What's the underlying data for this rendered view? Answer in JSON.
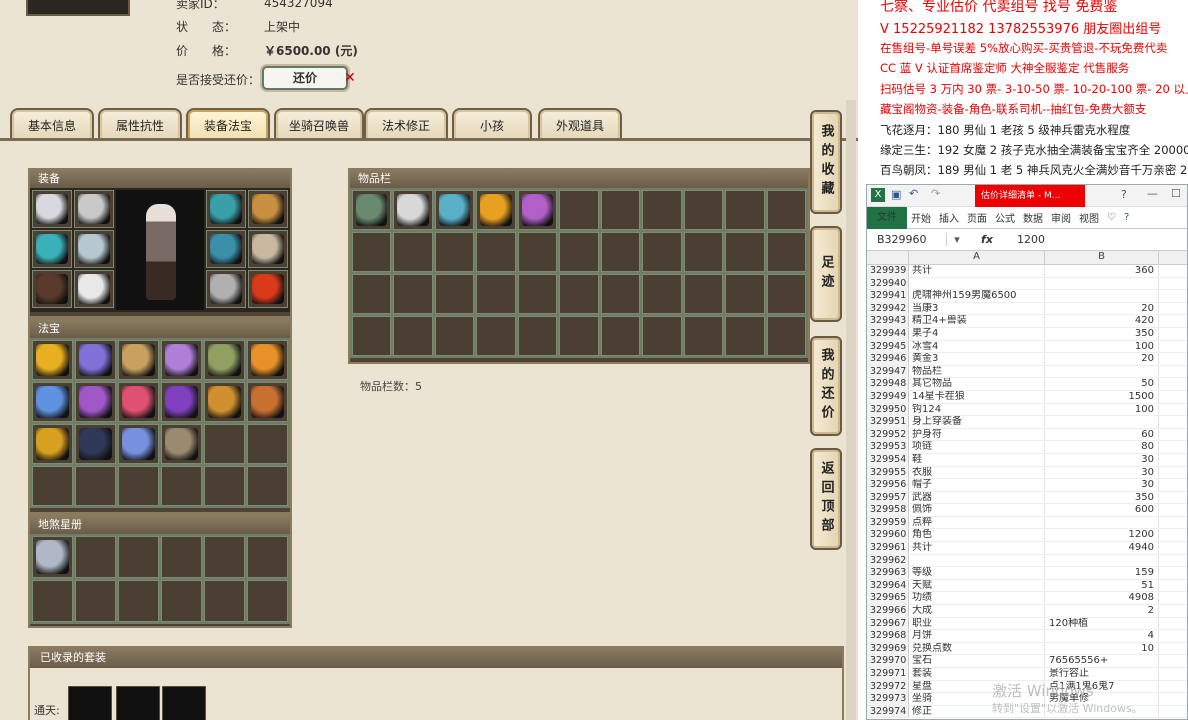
{
  "seller": {
    "id_label": "卖家ID：",
    "id_value": "454327094",
    "status_label": "状　　态：",
    "status_value": "上架中",
    "price_label": "价　　格：",
    "price_value": "￥6500.00 (元)",
    "offer_label": "是否接受还价：",
    "offer_button": "还价"
  },
  "tabs": [
    "基本信息",
    "属性抗性",
    "装备法宝",
    "坐骑召唤兽",
    "法术修正",
    "小孩",
    "外观道具"
  ],
  "panels": {
    "equip_title": "装备",
    "treasure_title": "法宝",
    "book_title": "地煞星册",
    "inventory_title": "物品栏",
    "inventory_count": "物品栏数：5",
    "suit_title": "已收录的套装",
    "suit_label": "通天:"
  },
  "side_nav": [
    "我的收藏",
    "足迹",
    "我的还价",
    "返回顶部"
  ],
  "colors": {
    "equip": [
      "#d8d8e0",
      "#c9c9c9",
      "#3ab0b8",
      "#b8c8d0",
      "#5a3a2a",
      "#e8e8e8",
      "#38a0a8",
      "#c89040",
      "#3a90a8",
      "#c8b8a0",
      "#b0b0b0",
      "#d83a1a"
    ],
    "inventory": [
      "#6a8a70",
      "#d8d8d8",
      "#5ab0c8",
      "#e8a020",
      "#b060c8"
    ],
    "treasure": [
      "#e8b020",
      "#8070d8",
      "#c8a060",
      "#b080d8",
      "#90a060",
      "#e8902a",
      "#6090e0",
      "#a058c8",
      "#e05070",
      "#8040c0",
      "#d09030",
      "#c87030",
      "#d8a020",
      "#303858",
      "#7890e0",
      "#9a8a70"
    ],
    "book": [
      "#b0b8c8"
    ]
  },
  "ads": {
    "line0": "七察、专业估价 代卖组号 找号 免费鉴",
    "line1": "V 15225921182   13782553976 朋友圈出组号",
    "line2": "在售组号-单号误差 5%放心购买-买贵管退-不玩免费代卖",
    "line3": "CC 蓝 V 认证首席鉴定师 大神全服鉴定 代售服务",
    "line4": "扫码估号 3 万内 30 票- 3-10-50 票- 10-20-100 票- 20 以上 150",
    "line5": "藏宝阁物资-装备-角色-联系司机--抽红包-免费大额支",
    "line6": "飞花逐月：180 男仙 1 老孩 5 级神兵雷克水程度",
    "line7": "缘定三生：192 女魔 2 孩子克水抽全满装备宝宝齐全 20000",
    "line8": "百鸟朝凤：189 男仙 1 老 5 神兵风克火全满妙音千万亲密 228"
  },
  "excel": {
    "tab_title": "估价详细清单 - M...",
    "ribbon": [
      "文件",
      "开始",
      "插入",
      "页面",
      "公式",
      "数据",
      "审阅",
      "视图"
    ],
    "cell_ref": "B329960",
    "fx": "fx",
    "formula_value": "1200",
    "col_a": "A",
    "col_b": "B",
    "rows": [
      [
        "329939",
        "共计",
        "360"
      ],
      [
        "329940",
        "",
        ""
      ],
      [
        "329941",
        "虎啸神州159男魔6500",
        ""
      ],
      [
        "329942",
        "当康3",
        "20"
      ],
      [
        "329943",
        "精卫4+兽装",
        "420"
      ],
      [
        "329944",
        "果子4",
        "350"
      ],
      [
        "329945",
        "冰雪4",
        "100"
      ],
      [
        "329946",
        "黄金3",
        "20"
      ],
      [
        "329947",
        "物品栏",
        ""
      ],
      [
        "329948",
        "其它物品",
        "50"
      ],
      [
        "329949",
        "14星卡茬狼",
        "1500"
      ],
      [
        "329950",
        "钩124",
        "100"
      ],
      [
        "329951",
        "身上穿装备",
        ""
      ],
      [
        "329952",
        "护身符",
        "60"
      ],
      [
        "329953",
        "项链",
        "80"
      ],
      [
        "329954",
        "鞋",
        "30"
      ],
      [
        "329955",
        "衣服",
        "30"
      ],
      [
        "329956",
        "帽子",
        "30"
      ],
      [
        "329957",
        "武器",
        "350"
      ],
      [
        "329958",
        "佩饰",
        "600"
      ],
      [
        "329959",
        "点粹",
        ""
      ],
      [
        "329960",
        "角色",
        "1200"
      ],
      [
        "329961",
        "共计",
        "4940"
      ],
      [
        "329962",
        "",
        ""
      ],
      [
        "329963",
        "等级",
        "159"
      ],
      [
        "329964",
        "天赋",
        "51"
      ],
      [
        "329965",
        "功绩",
        "4908"
      ],
      [
        "329966",
        "大成",
        "2"
      ],
      [
        "329967",
        "职业",
        "120种植"
      ],
      [
        "329968",
        "月饼",
        "4"
      ],
      [
        "329969",
        "兑换点数",
        "10"
      ],
      [
        "329970",
        "宝石",
        "76565556+"
      ],
      [
        "329971",
        "套装",
        "景行容止"
      ],
      [
        "329972",
        "星盘",
        "点1满1鬼6鬼7"
      ],
      [
        "329973",
        "坐骑",
        "男魔单修"
      ],
      [
        "329974",
        "修正",
        ""
      ]
    ]
  },
  "watermark": {
    "line1": "激活 Windows",
    "line2": "转到\"设置\"以激活 Windows。"
  }
}
